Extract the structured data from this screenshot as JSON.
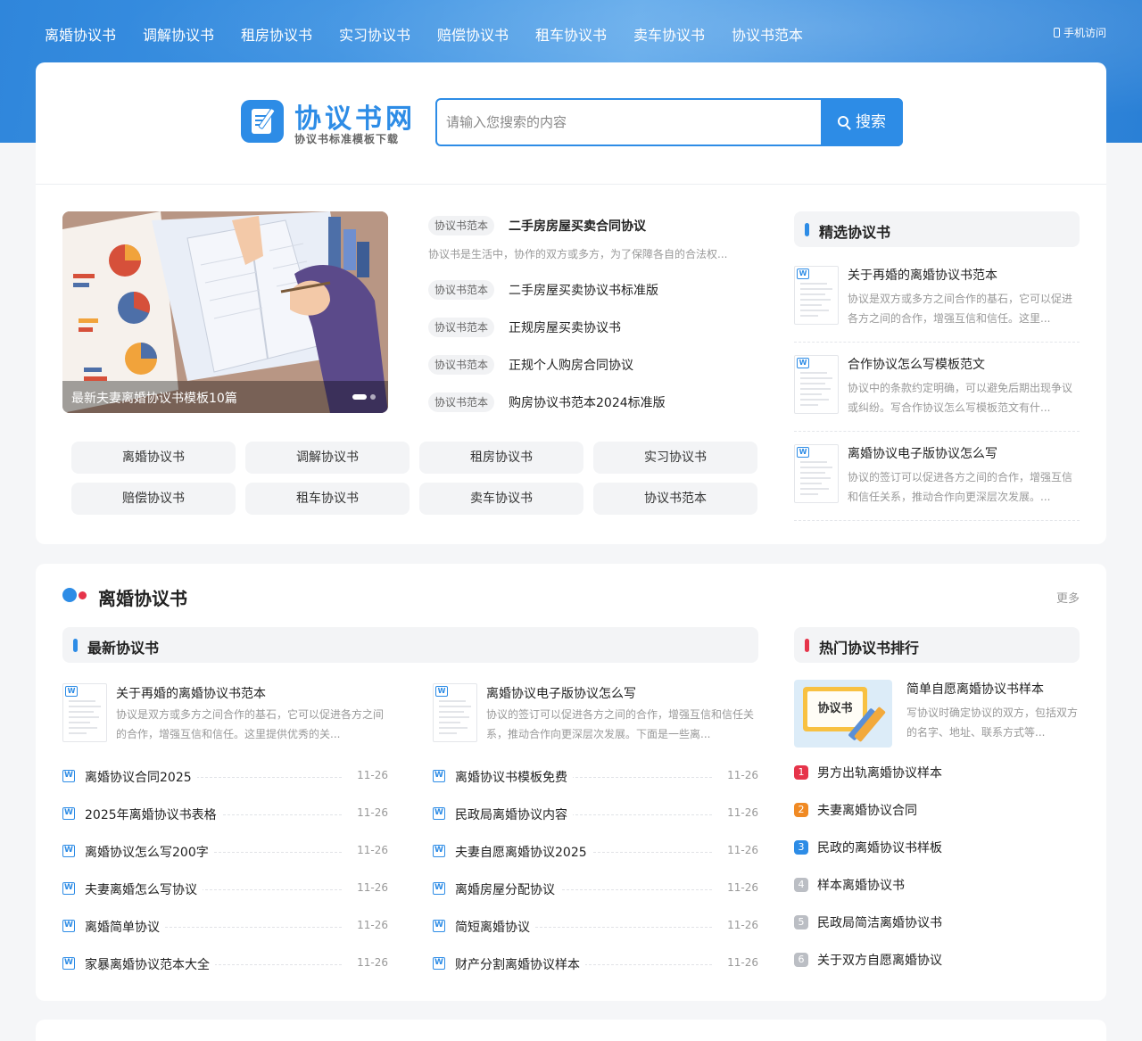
{
  "nav": {
    "items": [
      "离婚协议书",
      "调解协议书",
      "租房协议书",
      "实习协议书",
      "赔偿协议书",
      "租车协议书",
      "卖车协议书",
      "协议书范本"
    ],
    "mobile": "手机访问"
  },
  "logo": {
    "title": "协议书网",
    "subtitle": "协议书标准模板下载"
  },
  "search": {
    "placeholder": "请输入您搜索的内容",
    "button": "搜索"
  },
  "banner": {
    "caption": "最新夫妻离婚协议书模板10篇"
  },
  "headlines": [
    {
      "tag": "协议书范本",
      "title": "二手房房屋买卖合同协议",
      "desc": "协议书是生活中，协作的双方或多方，为了保障各自的合法权..."
    },
    {
      "tag": "协议书范本",
      "title": "二手房屋买卖协议书标准版"
    },
    {
      "tag": "协议书范本",
      "title": "正规房屋买卖协议书"
    },
    {
      "tag": "协议书范本",
      "title": "正规个人购房合同协议"
    },
    {
      "tag": "协议书范本",
      "title": "购房协议书范本2024标准版"
    }
  ],
  "categories": [
    "离婚协议书",
    "调解协议书",
    "租房协议书",
    "实习协议书",
    "赔偿协议书",
    "租车协议书",
    "卖车协议书",
    "协议书范本"
  ],
  "featured": {
    "heading": "精选协议书",
    "items": [
      {
        "title": "关于再婚的离婚协议书范本",
        "desc": "协议是双方或多方之间合作的基石，它可以促进各方之间的合作，增强互信和信任。这里..."
      },
      {
        "title": "合作协议怎么写模板范文",
        "desc": "协议中的条款约定明确，可以避免后期出现争议或纠纷。写合作协议怎么写模板范文有什..."
      },
      {
        "title": "离婚协议电子版协议怎么写",
        "desc": "协议的签订可以促进各方之间的合作，增强互信和信任关系，推动合作向更深层次发展。..."
      }
    ]
  },
  "section": {
    "title": "离婚协议书",
    "more": "更多",
    "latest_heading": "最新协议书",
    "hot_heading": "热门协议书排行",
    "latest_featured": [
      {
        "title": "关于再婚的离婚协议书范本",
        "desc": "协议是双方或多方之间合作的基石，它可以促进各方之间的合作，增强互信和信任。这里提供优秀的关..."
      },
      {
        "title": "离婚协议电子版协议怎么写",
        "desc": "协议的签订可以促进各方之间的合作，增强互信和信任关系，推动合作向更深层次发展。下面是一些离..."
      }
    ],
    "list_left": [
      {
        "title": "离婚协议合同2025",
        "date": "11-26"
      },
      {
        "title": "2025年离婚协议书表格",
        "date": "11-26"
      },
      {
        "title": "离婚协议怎么写200字",
        "date": "11-26"
      },
      {
        "title": "夫妻离婚怎么写协议",
        "date": "11-26"
      },
      {
        "title": "离婚简单协议",
        "date": "11-26"
      },
      {
        "title": "家暴离婚协议范本大全",
        "date": "11-26"
      }
    ],
    "list_right": [
      {
        "title": "离婚协议书模板免费",
        "date": "11-26"
      },
      {
        "title": "民政局离婚协议内容",
        "date": "11-26"
      },
      {
        "title": "夫妻自愿离婚协议2025",
        "date": "11-26"
      },
      {
        "title": "离婚房屋分配协议",
        "date": "11-26"
      },
      {
        "title": "简短离婚协议",
        "date": "11-26"
      },
      {
        "title": "财产分割离婚协议样本",
        "date": "11-26"
      }
    ],
    "hot_featured": {
      "image_text": "协议书",
      "title": "简单自愿离婚协议书样本",
      "desc": "写协议时确定协议的双方，包括双方的名字、地址、联系方式等..."
    },
    "hot_list": [
      {
        "rank": "1",
        "title": "男方出轨离婚协议样本",
        "color": "#e6344a"
      },
      {
        "rank": "2",
        "title": "夫妻离婚协议合同",
        "color": "#f08a24"
      },
      {
        "rank": "3",
        "title": "民政的离婚协议书样板",
        "color": "#2d8ce6"
      },
      {
        "rank": "4",
        "title": "样本离婚协议书",
        "color": "#bbbec4"
      },
      {
        "rank": "5",
        "title": "民政局简洁离婚协议书",
        "color": "#bbbec4"
      },
      {
        "rank": "6",
        "title": "关于双方自愿离婚协议",
        "color": "#bbbec4"
      }
    ],
    "doc_icon_letter": "W"
  }
}
